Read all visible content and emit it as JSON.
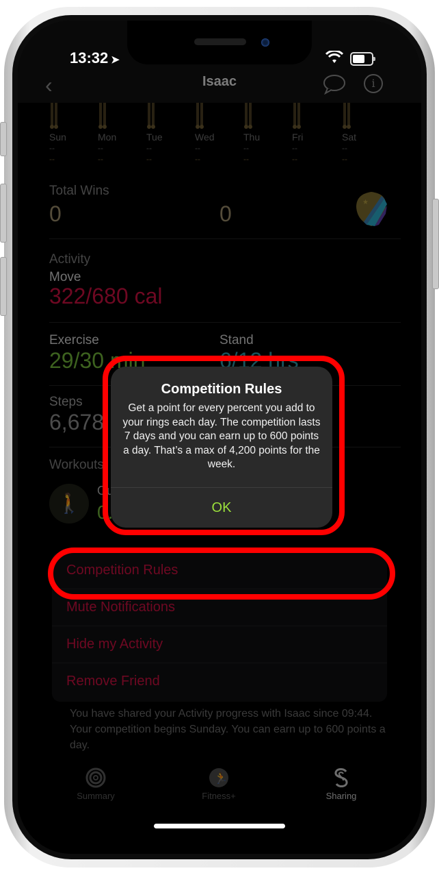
{
  "status_bar": {
    "time": "13:32",
    "location_icon": "location-arrow-icon",
    "wifi_icon": "wifi-icon",
    "battery_icon": "battery-icon"
  },
  "nav": {
    "back_icon": "chevron-left-icon",
    "title": "Isaac",
    "message_icon": "message-bubble-icon",
    "info_icon": "info-icon",
    "info_glyph": "i"
  },
  "week": {
    "days": [
      {
        "label": "Sun",
        "me": "--",
        "friend": "--"
      },
      {
        "label": "Mon",
        "me": "--",
        "friend": "--"
      },
      {
        "label": "Tue",
        "me": "--",
        "friend": "--"
      },
      {
        "label": "Wed",
        "me": "--",
        "friend": "--"
      },
      {
        "label": "Thu",
        "me": "--",
        "friend": "--"
      },
      {
        "label": "Fri",
        "me": "--",
        "friend": "--"
      },
      {
        "label": "Sat",
        "me": "--",
        "friend": "--"
      }
    ]
  },
  "total_wins": {
    "label": "Total Wins",
    "me": "0",
    "friend": "0",
    "badge_icon": "competition-badge-icon"
  },
  "activity": {
    "label": "Activity",
    "move": {
      "label": "Move",
      "value": "322/680 cal",
      "color": "#c8103e"
    },
    "exercise": {
      "label": "Exercise",
      "value": "29/30 min",
      "color": "#7cc23a"
    },
    "stand": {
      "label": "Stand",
      "value": "6/12 hrs",
      "color": "#3ab7c7"
    }
  },
  "steps": {
    "label": "Steps",
    "value": "6,678"
  },
  "workouts": {
    "label": "Workouts",
    "workout_icon": "walking-icon",
    "title": "Outdoor Walk",
    "value": "0.51 km"
  },
  "menu": {
    "items": [
      {
        "label": "Competition Rules"
      },
      {
        "label": "Mute Notifications"
      },
      {
        "label": "Hide my Activity"
      },
      {
        "label": "Remove Friend"
      }
    ]
  },
  "footer": {
    "shared_text": "You have shared your Activity progress with Isaac since 09:44.",
    "competition_text": "Your competition begins Sunday. You can earn up to 600 points a day."
  },
  "tabbar": {
    "tabs": [
      {
        "label": "Summary",
        "icon": "activity-rings-icon",
        "active": false
      },
      {
        "label": "Fitness+",
        "icon": "fitness-runner-icon",
        "active": false
      },
      {
        "label": "Sharing",
        "icon": "sharing-icon",
        "active": true
      }
    ]
  },
  "alert": {
    "title": "Competition Rules",
    "message": "Get a point for every percent you add to your rings each day. The competition lasts 7 days and you can earn up to 600 points a day. That’s a max of 4,200 points for the week.",
    "ok_label": "OK",
    "ok_color": "#9be03c"
  },
  "annotations": {
    "highlight_color": "#ff0000"
  }
}
